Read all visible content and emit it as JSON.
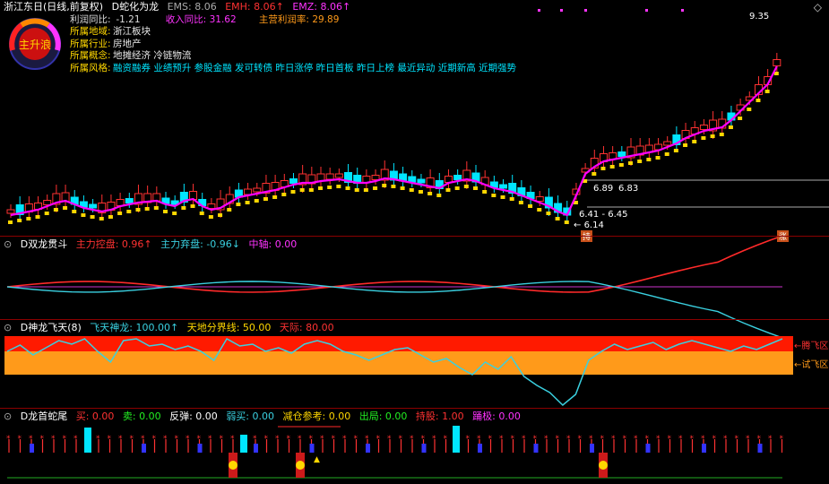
{
  "header": {
    "stock": "浙江东日(日线,前复权)",
    "indicator": "D蛇化为龙",
    "ema5": "EMS: 8.06",
    "emh": "EMH: 8.06↑",
    "emz": "EMZ: 8.06↑"
  },
  "info": {
    "profit_yoy_label": "利润同比:",
    "profit_yoy": "-1.21",
    "revenue_yoy_label": "收入同比:",
    "revenue_yoy": "31.62",
    "main_margin_label": "主营利润率:",
    "main_margin": "29.89",
    "region_label": "所属地域:",
    "region": "浙江板块",
    "industry_label": "所属行业:",
    "industry": "房地产",
    "concept_label": "所属概念:",
    "concept": "地摊经济 冷链物流",
    "style_label": "所属风格:",
    "style": "融资融券 业绩预升 参股金融 发可转债 昨日涨停 昨日首板 昨日上榜 最近异动 近期新高 近期强势"
  },
  "gauge_text": "主升浪",
  "price_labels": {
    "high": "9.35",
    "mid1": "6.89",
    "mid2": "6.83",
    "range": "6.41 - 6.45",
    "low": "6.14",
    "buy_tag": "持",
    "limit_tag": "涨"
  },
  "panel2": {
    "title": "D双龙贯斗",
    "a": "主力控盘: 0.96↑",
    "b": "主力弃盘: -0.96↓",
    "c": "中轴: 0.00"
  },
  "panel3": {
    "title": "D神龙飞天(8)",
    "a": "飞天神龙: 100.00↑",
    "b": "天地分界线: 50.00",
    "c": "天际: 80.00",
    "zone1": "←腾飞区",
    "zone2": "←试飞区"
  },
  "panel4": {
    "title": "D龙首蛇尾",
    "buy": "买: 0.00",
    "sell": "卖: 0.00",
    "rebound": "反弹: 0.00",
    "weak_buy": "弱买: 0.00",
    "reduce": "减仓参考: 0.00",
    "exit": "出局: 0.00",
    "hold": "持股: 1.00",
    "bottom": "踊极: 0.00"
  },
  "colors": {
    "up": "#ff3232",
    "down": "#00e5ff",
    "ema_mid": "#ff00ff",
    "zone_red": "#ff1a00",
    "zone_orange": "#ff9a1a"
  }
}
